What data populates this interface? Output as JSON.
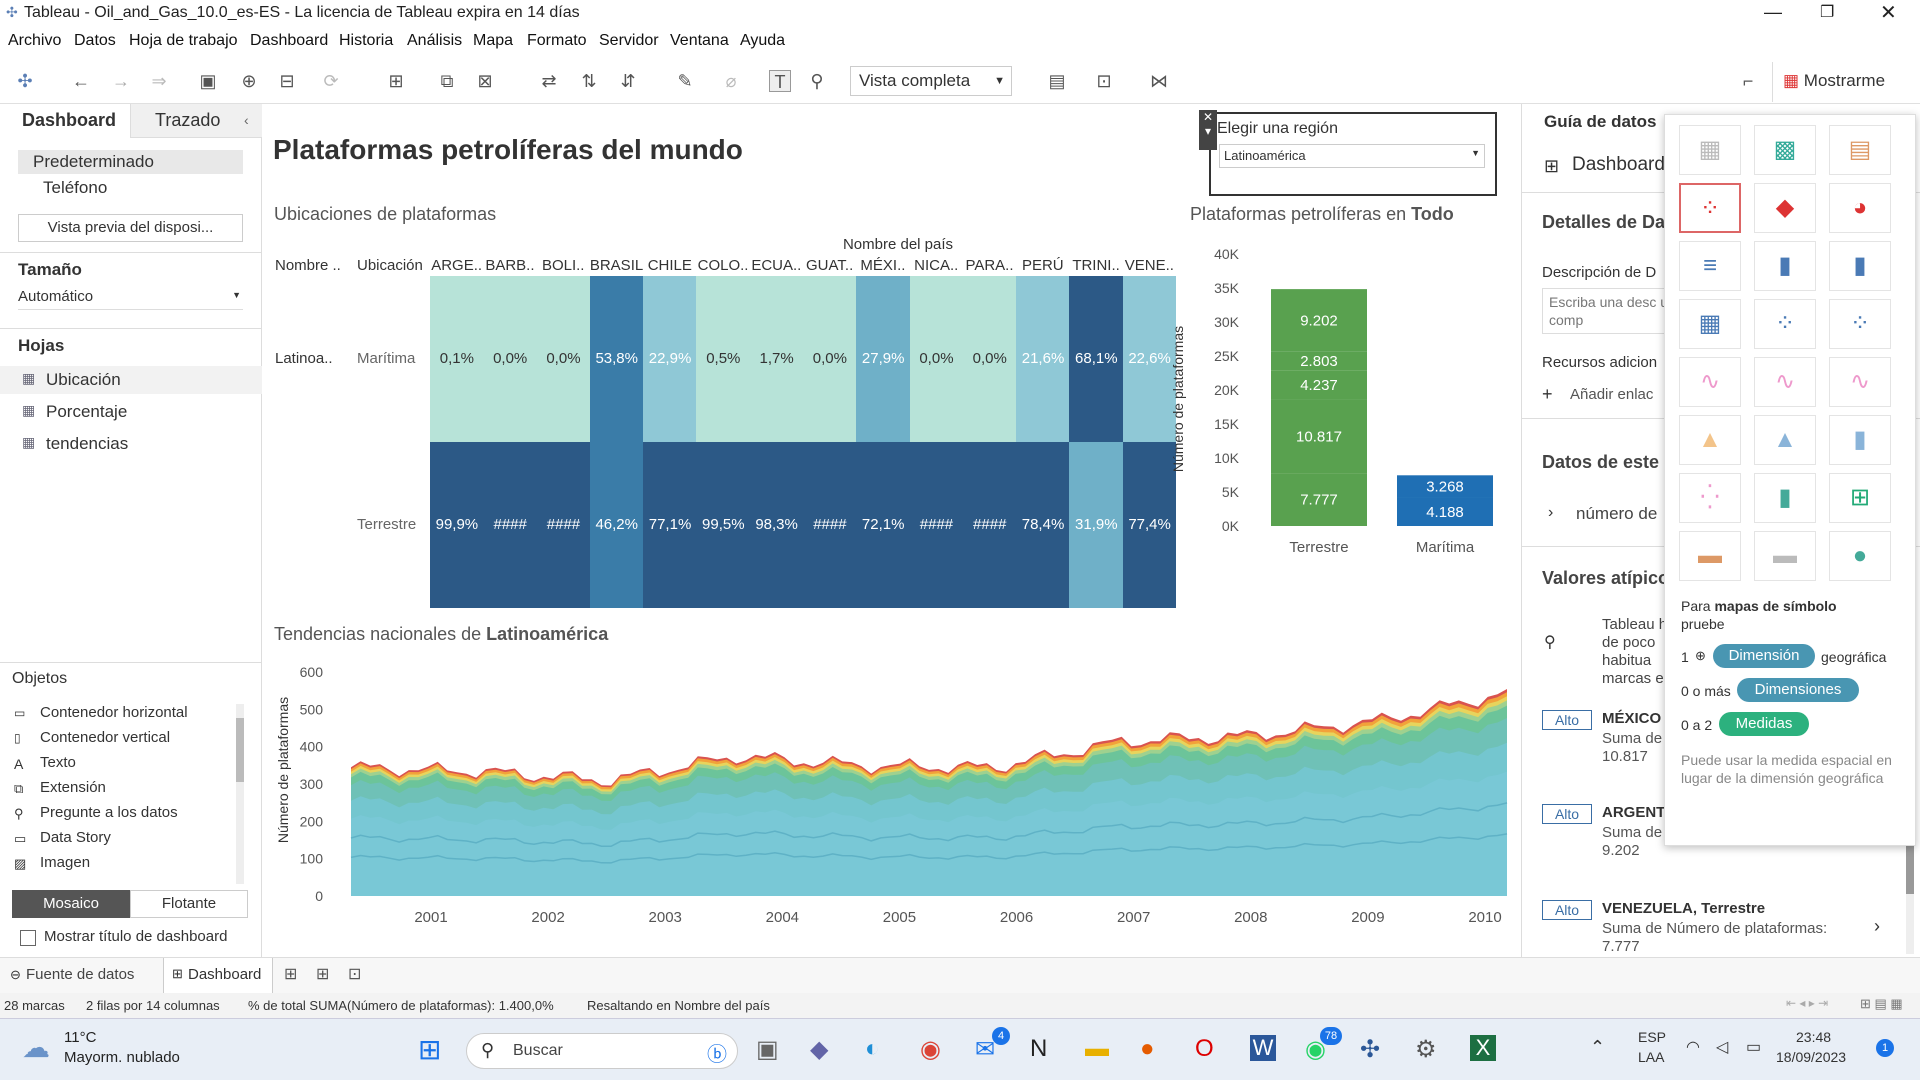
{
  "window": {
    "title": "Tableau - Oil_and_Gas_10.0_es-ES - La licencia de Tableau expira en 14 días"
  },
  "menu": [
    "Archivo",
    "Datos",
    "Hoja de trabajo",
    "Dashboard",
    "Historia",
    "Análisis",
    "Mapa",
    "Formato",
    "Servidor",
    "Ventana",
    "Ayuda"
  ],
  "toolbar": {
    "view_select": "Vista completa",
    "show_me": "Mostrarme"
  },
  "left": {
    "tabs": [
      "Dashboard",
      "Trazado"
    ],
    "devices": [
      "Predeterminado",
      "Teléfono"
    ],
    "preview_button": "Vista previa del disposi...",
    "size_label": "Tamaño",
    "size_value": "Automático",
    "sheets_label": "Hojas",
    "sheets": [
      "Ubicación",
      "Porcentaje",
      "tendencias"
    ],
    "objects_label": "Objetos",
    "objects": [
      "Contenedor horizontal",
      "Contenedor vertical",
      "Texto",
      "Extensión",
      "Pregunte a los datos",
      "Data Story",
      "Imagen"
    ],
    "layout_buttons": [
      "Mosaico",
      "Flotante"
    ],
    "show_title": "Mostrar título de dashboard"
  },
  "dashboard": {
    "title": "Plataformas petrolíferas del mundo",
    "region_filter": {
      "label": "Elegir una región",
      "value": "Latinoamérica"
    },
    "heatmap": {
      "title": "Ubicaciones de plataformas",
      "col_group": "Nombre del país",
      "row_headers": [
        "Nombre ..",
        "Ubicación"
      ],
      "region": "Latinoa..",
      "countries": [
        "ARGE..",
        "BARB..",
        "BOLI..",
        "BRASIL",
        "CHILE",
        "COLO..",
        "ECUA..",
        "GUAT..",
        "MÉXI..",
        "NICA..",
        "PARA..",
        "PERÚ",
        "TRINI..",
        "VENE.."
      ],
      "rows": [
        {
          "label": "Marítima",
          "values": [
            "0,1%",
            "0,0%",
            "0,0%",
            "53,8%",
            "22,9%",
            "0,5%",
            "1,7%",
            "0,0%",
            "27,9%",
            "0,0%",
            "0,0%",
            "21,6%",
            "68,1%",
            "22,6%"
          ]
        },
        {
          "label": "Terrestre",
          "values": [
            "99,9%",
            "####",
            "####",
            "46,2%",
            "77,1%",
            "99,5%",
            "98,3%",
            "####",
            "72,1%",
            "####",
            "####",
            "78,4%",
            "31,9%",
            "77,4%"
          ]
        }
      ]
    },
    "bar": {
      "title_prefix": "Plataformas petrolíferas en ",
      "title_bold": "Todo",
      "ylabel": "Número de plataformas"
    },
    "area": {
      "title_prefix": "Tendencias nacionales de ",
      "title_bold": "Latinoamérica",
      "ylabel": "Número de plataformas"
    }
  },
  "chart_data": [
    {
      "type": "bar",
      "title": "Plataformas petrolíferas en Todo",
      "categories": [
        "Terrestre",
        "Marítima"
      ],
      "series": [
        {
          "values": [
            9202,
            0
          ]
        },
        {
          "values": [
            2803,
            0
          ]
        },
        {
          "values": [
            4237,
            0
          ]
        },
        {
          "values": [
            10817,
            3268
          ]
        },
        {
          "values": [
            7777,
            4188
          ]
        }
      ],
      "segments": {
        "Terrestre": [
          7777,
          10817,
          4237,
          2803,
          9202
        ],
        "Marítima": [
          4188,
          3268
        ]
      },
      "segment_labels": {
        "Terrestre": [
          "7.777",
          "10.817",
          "4.237",
          "2.803",
          "9.202"
        ],
        "Marítima": [
          "4.188",
          "3.268"
        ]
      },
      "ylabel": "Número de plataformas",
      "yticks": [
        "0K",
        "5K",
        "10K",
        "15K",
        "20K",
        "25K",
        "30K",
        "35K",
        "40K"
      ],
      "ylim": [
        0,
        40000
      ]
    },
    {
      "type": "area",
      "title": "Tendencias nacionales de Latinoamérica",
      "ylabel": "Número de plataformas",
      "x": [
        "2001",
        "2002",
        "2003",
        "2004",
        "2005",
        "2006",
        "2007",
        "2008",
        "2009",
        "2010"
      ],
      "total": [
        345,
        335,
        310,
        375,
        350,
        345,
        415,
        430,
        470,
        545
      ],
      "yticks": [
        "0",
        "100",
        "200",
        "300",
        "400",
        "500",
        "600"
      ],
      "ylim": [
        0,
        600
      ]
    }
  ],
  "right_panel": {
    "title": "Guía de datos",
    "dashboard_label": "Dashboard",
    "details": "Detalles de Da",
    "desc_label": "Descripción de D",
    "desc_placeholder": "Escriba una desc usuarios a comp",
    "resources": "Recursos adicion",
    "add_link": "Añadir enlac",
    "data_label": "Datos de este",
    "data_item": "número de",
    "outliers": "Valores atípico",
    "outlier_text": "Tableau ha de poco habitua marcas en la",
    "outlier_items": [
      {
        "badge": "Alto",
        "name": "MÉXICO",
        "sub": "Suma de",
        "value": "10.817"
      },
      {
        "badge": "Alto",
        "name": "ARGENT",
        "sub": "Suma de",
        "value": "9.202"
      },
      {
        "badge": "Alto",
        "name": "VENEZUELA, Terrestre",
        "sub": "Suma de Número de plataformas:",
        "value": "7.777"
      }
    ]
  },
  "show_me": {
    "hint_prefix": "Para ",
    "hint_bold": "mapas de símbolo",
    "hint_suffix": "pruebe",
    "req1_num": "1",
    "req1_pill": "Dimensión",
    "req1_suffix": "geográfica",
    "req2_num": "0 o más",
    "req2_pill": "Dimensiones",
    "req3_num": "0 a 2",
    "req3_pill": "Medidas",
    "note": "Puede usar la medida espacial en lugar de la dimensión geográfica"
  },
  "bottom_tabs": [
    "Fuente de datos",
    "Dashboard"
  ],
  "status": [
    "28 marcas",
    "2 filas por 14 columnas",
    "% de total SUMA(Número de plataformas): 1.400,0%",
    "Resaltando en Nombre del país"
  ],
  "taskbar": {
    "temp": "11°C",
    "weather": "Mayorm. nublado",
    "search": "Buscar",
    "lang1": "ESP",
    "lang2": "LAA",
    "time": "23:48",
    "date": "18/09/2023",
    "badge_mail": "4",
    "badge_whatsapp": "78",
    "badge_notif": "1"
  },
  "colors": {
    "heat_dark": "#2c5986",
    "heat_mid": "#3a7ca8",
    "heat_light": "#b5e2d6",
    "green": "#59a14f",
    "blue": "#1f6fb4"
  }
}
